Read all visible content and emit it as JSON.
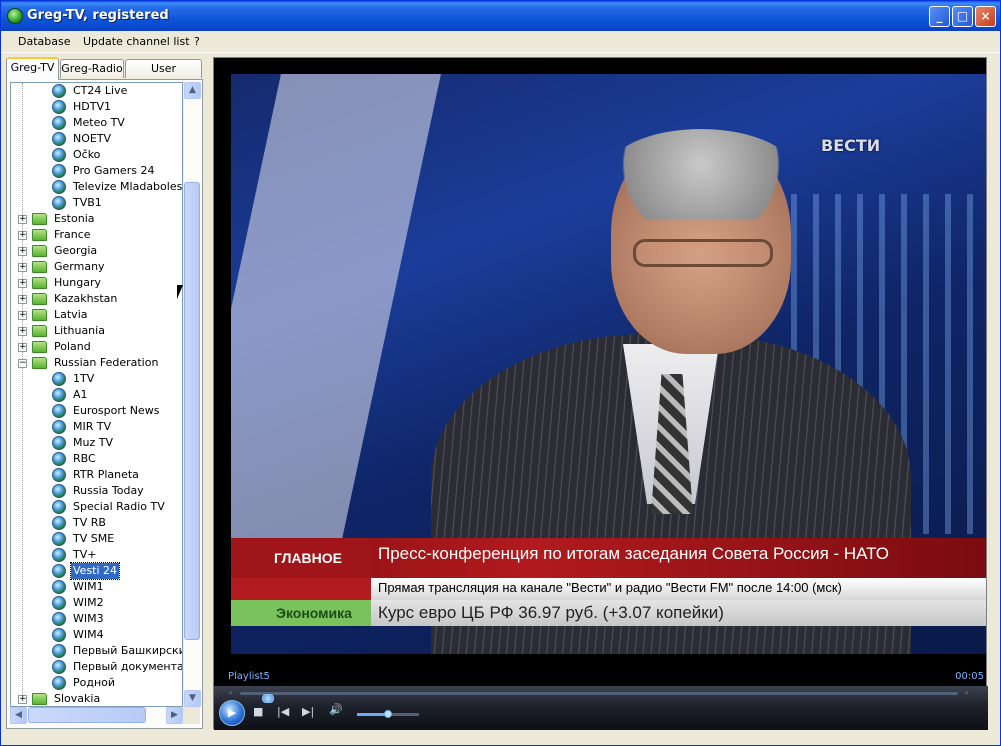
{
  "window": {
    "title": "Greg-TV, registered",
    "minimize_glyph": "_",
    "maximize_glyph": "□",
    "close_glyph": "×"
  },
  "menu": {
    "items": [
      "Database",
      "Update channel list",
      "?"
    ]
  },
  "tabs": [
    "Greg-TV",
    "Greg-Radio",
    "User channels"
  ],
  "tree": {
    "rows": [
      {
        "kind": "channel",
        "label": "CT24 Live"
      },
      {
        "kind": "channel",
        "label": "HDTV1"
      },
      {
        "kind": "channel",
        "label": "Meteo TV"
      },
      {
        "kind": "channel",
        "label": "NOETV"
      },
      {
        "kind": "channel",
        "label": "Očko"
      },
      {
        "kind": "channel",
        "label": "Pro Gamers 24"
      },
      {
        "kind": "channel",
        "label": "Televize Mladaboleslav"
      },
      {
        "kind": "channel",
        "label": "TVB1"
      },
      {
        "kind": "folder",
        "label": "Estonia",
        "expander": "+"
      },
      {
        "kind": "folder",
        "label": "France",
        "expander": "+"
      },
      {
        "kind": "folder",
        "label": "Georgia",
        "expander": "+"
      },
      {
        "kind": "folder",
        "label": "Germany",
        "expander": "+"
      },
      {
        "kind": "folder",
        "label": "Hungary",
        "expander": "+"
      },
      {
        "kind": "folder",
        "label": "Kazakhstan",
        "expander": "+"
      },
      {
        "kind": "folder",
        "label": "Latvia",
        "expander": "+"
      },
      {
        "kind": "folder",
        "label": "Lithuania",
        "expander": "+"
      },
      {
        "kind": "folder",
        "label": "Poland",
        "expander": "+"
      },
      {
        "kind": "folder",
        "label": "Russian Federation",
        "expander": "−"
      },
      {
        "kind": "channel",
        "label": "1TV"
      },
      {
        "kind": "channel",
        "label": "A1"
      },
      {
        "kind": "channel",
        "label": "Eurosport News"
      },
      {
        "kind": "channel",
        "label": "MIR TV"
      },
      {
        "kind": "channel",
        "label": "Muz TV"
      },
      {
        "kind": "channel",
        "label": "RBC"
      },
      {
        "kind": "channel",
        "label": "RTR Planeta"
      },
      {
        "kind": "channel",
        "label": "Russia Today"
      },
      {
        "kind": "channel",
        "label": "Special Radio TV"
      },
      {
        "kind": "channel",
        "label": "TV RB"
      },
      {
        "kind": "channel",
        "label": "TV SME"
      },
      {
        "kind": "channel",
        "label": "TV+"
      },
      {
        "kind": "channel",
        "label": "Vesti 24",
        "selected": true
      },
      {
        "kind": "channel",
        "label": "WIM1"
      },
      {
        "kind": "channel",
        "label": "WIM2"
      },
      {
        "kind": "channel",
        "label": "WIM3"
      },
      {
        "kind": "channel",
        "label": "WIM4"
      },
      {
        "kind": "channel",
        "label": "Первый Башкирский"
      },
      {
        "kind": "channel",
        "label": "Первый документаль"
      },
      {
        "kind": "channel",
        "label": "Родной"
      },
      {
        "kind": "folder",
        "label": "Slovakia",
        "expander": "+"
      }
    ]
  },
  "scroll": {
    "up": "▲",
    "down": "▼",
    "left": "◀",
    "right": "▶"
  },
  "video": {
    "channel_logo": "ВЕСТИ",
    "ticker_label_1": "ГЛАВНОЕ",
    "ticker_text_1": "Пресс-конференция по итогам заседания Совета Россия - НАТО",
    "ticker_text_2": "Прямая трансляция на канале \"Вести\" и радио \"Вести FM\" после 14:00 (мск)",
    "ticker_label_3": "Экономика",
    "ticker_text_3": "Курс евро ЦБ РФ 36.97 руб. (+3.07 копейки)"
  },
  "player": {
    "playlist": "Playlist5",
    "time": "00:05",
    "seek_left": "«",
    "seek_right": "»",
    "play_glyph": "▶",
    "stop_glyph": "■",
    "prev_glyph": "|◀",
    "next_glyph": "▶|",
    "volume_glyph": "🔊",
    "seek_position": 0.03,
    "volume_level": 0.5
  }
}
